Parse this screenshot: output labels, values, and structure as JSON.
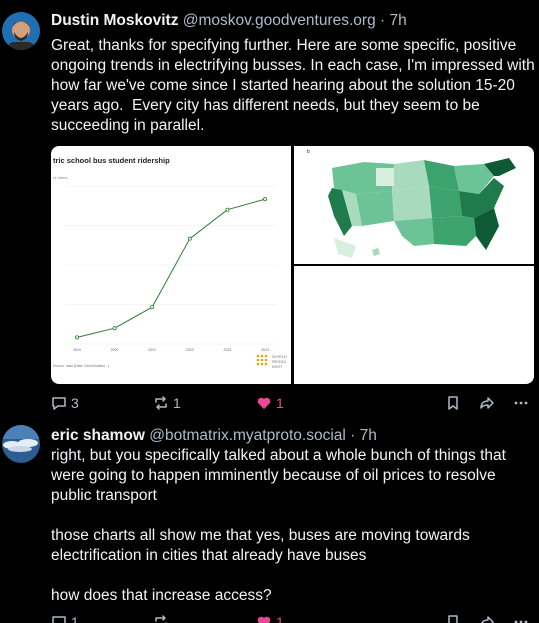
{
  "posts": [
    {
      "name": "Dustin Moskovitz",
      "handle": "@moskov.goodventures.org",
      "sep": "·",
      "time": "7h",
      "text": "Great, thanks for specifying further. Here are some specific, positive ongoing trends in electrifying busses. In each case, I'm impressed with how far we've come since I started hearing about the solution 15-20 years ago.  Every city has different needs, but they seem to be succeeding in parallel.",
      "images": {
        "chart": {
          "title": "tric school bus student ridership",
          "subtitle": "of riders",
          "source": "Source: data (Data: Electrification...)",
          "logo_text": [
            "WORLD",
            "RESOU",
            "INSTI"
          ]
        },
        "map": {
          "corner_label": "b"
        }
      },
      "replies": "3",
      "reposts": "1",
      "likes": "1",
      "liked": true,
      "avatar_colors": {
        "bg": "#1f6fb3",
        "face": "#d2a07a",
        "hair": "#3a2618"
      }
    },
    {
      "name": "eric shamow",
      "handle": "@botmatrix.myatproto.social",
      "sep": "·",
      "time": "7h",
      "text": "right, but you specifically talked about a whole bunch of things that were going to happen imminently because of oil prices to resolve public transport\n\nthose charts all show me that yes, buses are moving towards electrification in cities that already have buses\n\nhow does that increase access?",
      "replies": "1",
      "reposts": "",
      "likes": "1",
      "liked": true,
      "avatar_colors": {
        "bg": "#2b5f93",
        "cloud": "#e6eef5"
      }
    }
  ],
  "chart_data": {
    "type": "line",
    "title": "tric school bus student ridership",
    "subtitle": "of riders",
    "x": [
      "2019",
      "2020",
      "2021",
      "2022",
      "2023",
      "2024"
    ],
    "values": [
      0.5,
      1.2,
      2.8,
      8.0,
      10.2,
      11.0
    ],
    "ylim": [
      0,
      12
    ],
    "grid": true,
    "line_color": "#2e7d32"
  },
  "theme": {
    "bg": "#000000",
    "text": "#f1f3f5",
    "muted": "#aebbc9",
    "like": "#ec4899",
    "map_colors": [
      "#d8eedf",
      "#a8dbbd",
      "#6cc396",
      "#3ca36e",
      "#1f7a4c",
      "#0d5a34"
    ]
  }
}
